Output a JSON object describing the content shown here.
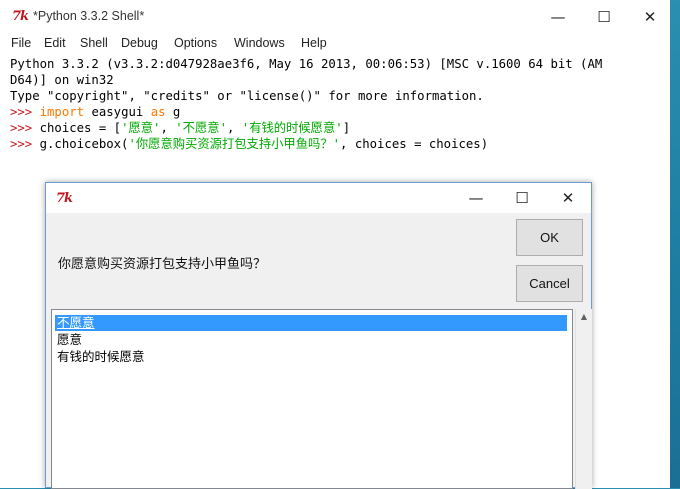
{
  "shell": {
    "title": "*Python 3.3.2 Shell*",
    "icon_text": "7k",
    "window_buttons": {
      "minimize": "—",
      "maximize": "☐",
      "close": "✕"
    },
    "menu": [
      "File",
      "Edit",
      "Shell",
      "Debug",
      "Options",
      "Windows",
      "Help"
    ],
    "console": {
      "banner1": "Python 3.3.2 (v3.3.2:d047928ae3f6, May 16 2013, 00:06:53) [MSC v.1600 64 bit (AM",
      "banner2": "D64)] on win32",
      "banner3": "Type \"copyright\", \"credits\" or \"license()\" for more information.",
      "prompt": ">>> ",
      "cmd1": {
        "kw1": "import",
        "mid": " easygui ",
        "kw2": "as",
        "tail": " g"
      },
      "cmd2": {
        "pre": "choices = [",
        "s1": "'愿意'",
        "sep1": ", ",
        "s2": "'不愿意'",
        "sep2": ", ",
        "s3": "'有钱的时候愿意'",
        "post": "]"
      },
      "cmd3": {
        "pre": "g.choicebox(",
        "s1": "'你愿意购买资源打包支持小甲鱼吗？'",
        "post": ", choices = choices)"
      }
    }
  },
  "dialog": {
    "icon_text": "7k",
    "window_buttons": {
      "minimize": "—",
      "maximize": "☐",
      "close": "✕"
    },
    "message": "你愿意购买资源打包支持小甲鱼吗？",
    "ok_label": "OK",
    "cancel_label": "Cancel",
    "choices": [
      "不愿意",
      "愿意",
      "有钱的时候愿意"
    ],
    "selected_index": 0
  },
  "colors": {
    "prompt": "#c0151b",
    "keyword": "#ff7700",
    "string": "#00aa00",
    "selection": "#3399ff"
  }
}
